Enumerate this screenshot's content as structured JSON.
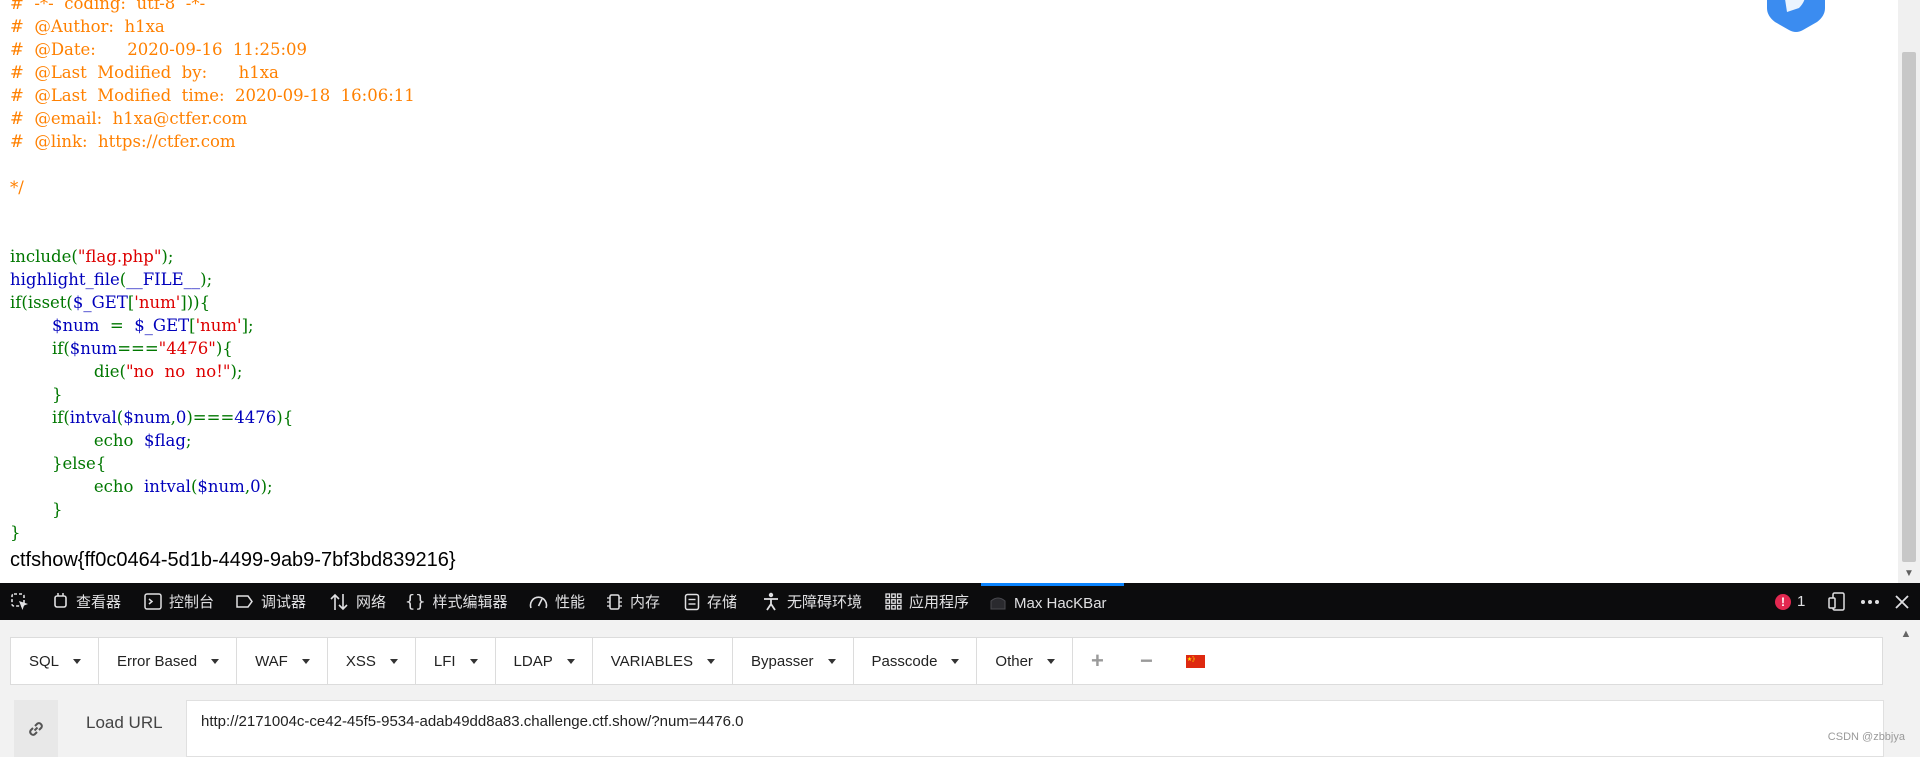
{
  "source_code": {
    "lines": [
      [
        {
          "t": "#  -*-  coding:  utf-8  -*-",
          "c": "comment"
        }
      ],
      [
        {
          "t": "#  @Author:  h1xa",
          "c": "comment"
        }
      ],
      [
        {
          "t": "#  @Date:      2020-09-16  11:25:09",
          "c": "comment"
        }
      ],
      [
        {
          "t": "#  @Last  Modified  by:      h1xa",
          "c": "comment"
        }
      ],
      [
        {
          "t": "#  @Last  Modified  time:  2020-09-18  16:06:11",
          "c": "comment"
        }
      ],
      [
        {
          "t": "#  @email:  h1xa@ctfer.com",
          "c": "comment"
        }
      ],
      [
        {
          "t": "#  @link:  https://ctfer.com",
          "c": "comment"
        }
      ],
      [
        {
          "t": "",
          "c": "comment"
        }
      ],
      [
        {
          "t": "*/",
          "c": "comment"
        }
      ],
      [
        {
          "t": "",
          "c": "default"
        }
      ],
      [
        {
          "t": "",
          "c": "default"
        }
      ],
      [
        {
          "t": "include(",
          "c": "keyword"
        },
        {
          "t": "\"flag.php\"",
          "c": "string"
        },
        {
          "t": ");",
          "c": "keyword"
        }
      ],
      [
        {
          "t": "highlight_file",
          "c": "default"
        },
        {
          "t": "(",
          "c": "keyword"
        },
        {
          "t": "__FILE__",
          "c": "default"
        },
        {
          "t": ");",
          "c": "keyword"
        }
      ],
      [
        {
          "t": "if(isset(",
          "c": "keyword"
        },
        {
          "t": "$_GET",
          "c": "default"
        },
        {
          "t": "[",
          "c": "keyword"
        },
        {
          "t": "'num'",
          "c": "string"
        },
        {
          "t": "])){",
          "c": "keyword"
        }
      ],
      [
        {
          "t": "        ",
          "c": "keyword"
        },
        {
          "t": "$num  ",
          "c": "default"
        },
        {
          "t": "=  ",
          "c": "keyword"
        },
        {
          "t": "$_GET",
          "c": "default"
        },
        {
          "t": "[",
          "c": "keyword"
        },
        {
          "t": "'num'",
          "c": "string"
        },
        {
          "t": "];",
          "c": "keyword"
        }
      ],
      [
        {
          "t": "        if(",
          "c": "keyword"
        },
        {
          "t": "$num",
          "c": "default"
        },
        {
          "t": "===",
          "c": "keyword"
        },
        {
          "t": "\"4476\"",
          "c": "string"
        },
        {
          "t": "){",
          "c": "keyword"
        }
      ],
      [
        {
          "t": "                die(",
          "c": "keyword"
        },
        {
          "t": "\"no  no  no!\"",
          "c": "string"
        },
        {
          "t": ");",
          "c": "keyword"
        }
      ],
      [
        {
          "t": "        }",
          "c": "keyword"
        }
      ],
      [
        {
          "t": "        if(",
          "c": "keyword"
        },
        {
          "t": "intval",
          "c": "default"
        },
        {
          "t": "(",
          "c": "keyword"
        },
        {
          "t": "$num",
          "c": "default"
        },
        {
          "t": ",",
          "c": "keyword"
        },
        {
          "t": "0",
          "c": "default"
        },
        {
          "t": ")===",
          "c": "keyword"
        },
        {
          "t": "4476",
          "c": "default"
        },
        {
          "t": "){",
          "c": "keyword"
        }
      ],
      [
        {
          "t": "                echo  ",
          "c": "keyword"
        },
        {
          "t": "$flag",
          "c": "default"
        },
        {
          "t": ";",
          "c": "keyword"
        }
      ],
      [
        {
          "t": "        }else{",
          "c": "keyword"
        }
      ],
      [
        {
          "t": "                echo  ",
          "c": "keyword"
        },
        {
          "t": "intval",
          "c": "default"
        },
        {
          "t": "(",
          "c": "keyword"
        },
        {
          "t": "$num",
          "c": "default"
        },
        {
          "t": ",",
          "c": "keyword"
        },
        {
          "t": "0",
          "c": "default"
        },
        {
          "t": ");",
          "c": "keyword"
        }
      ],
      [
        {
          "t": "        }",
          "c": "keyword"
        }
      ],
      [
        {
          "t": "}",
          "c": "keyword"
        }
      ]
    ],
    "flag_output": "ctfshow{ff0c0464-5d1b-4499-9ab9-7bf3bd839216}"
  },
  "colors": {
    "comment": "#ff8000",
    "default": "#0000bb",
    "keyword": "#007700",
    "string": "#dd0000",
    "devtools_bg": "#0c0c0d",
    "accent": "#0a84ff",
    "error": "#e22850"
  },
  "devtools": {
    "tabs": [
      {
        "id": "inspector",
        "label": "查看器",
        "icon": "inspector-icon"
      },
      {
        "id": "console",
        "label": "控制台",
        "icon": "console-icon"
      },
      {
        "id": "debugger",
        "label": "调试器",
        "icon": "debugger-icon"
      },
      {
        "id": "network",
        "label": "网络",
        "icon": "network-icon"
      },
      {
        "id": "style-editor",
        "label": "样式编辑器",
        "icon": "style-editor-icon"
      },
      {
        "id": "performance",
        "label": "性能",
        "icon": "performance-icon"
      },
      {
        "id": "memory",
        "label": "内存",
        "icon": "memory-icon"
      },
      {
        "id": "storage",
        "label": "存储",
        "icon": "storage-icon"
      },
      {
        "id": "accessibility",
        "label": "无障碍环境",
        "icon": "accessibility-icon"
      },
      {
        "id": "application",
        "label": "应用程序",
        "icon": "application-icon"
      },
      {
        "id": "hackbar",
        "label": "Max HacKBar",
        "icon": "hackbar-icon",
        "active": true
      }
    ],
    "error_count": "1"
  },
  "hackbar": {
    "menus": [
      "SQL",
      "Error Based",
      "WAF",
      "XSS",
      "LFI",
      "LDAP",
      "VARIABLES",
      "Bypasser",
      "Passcode",
      "Other"
    ],
    "load_url_label": "Load URL",
    "url_value": "http://2171004c-ce42-45f5-9534-adab49dd8a83.challenge.ctf.show/?num=4476.0"
  },
  "watermark": "CSDN @zbbjya"
}
